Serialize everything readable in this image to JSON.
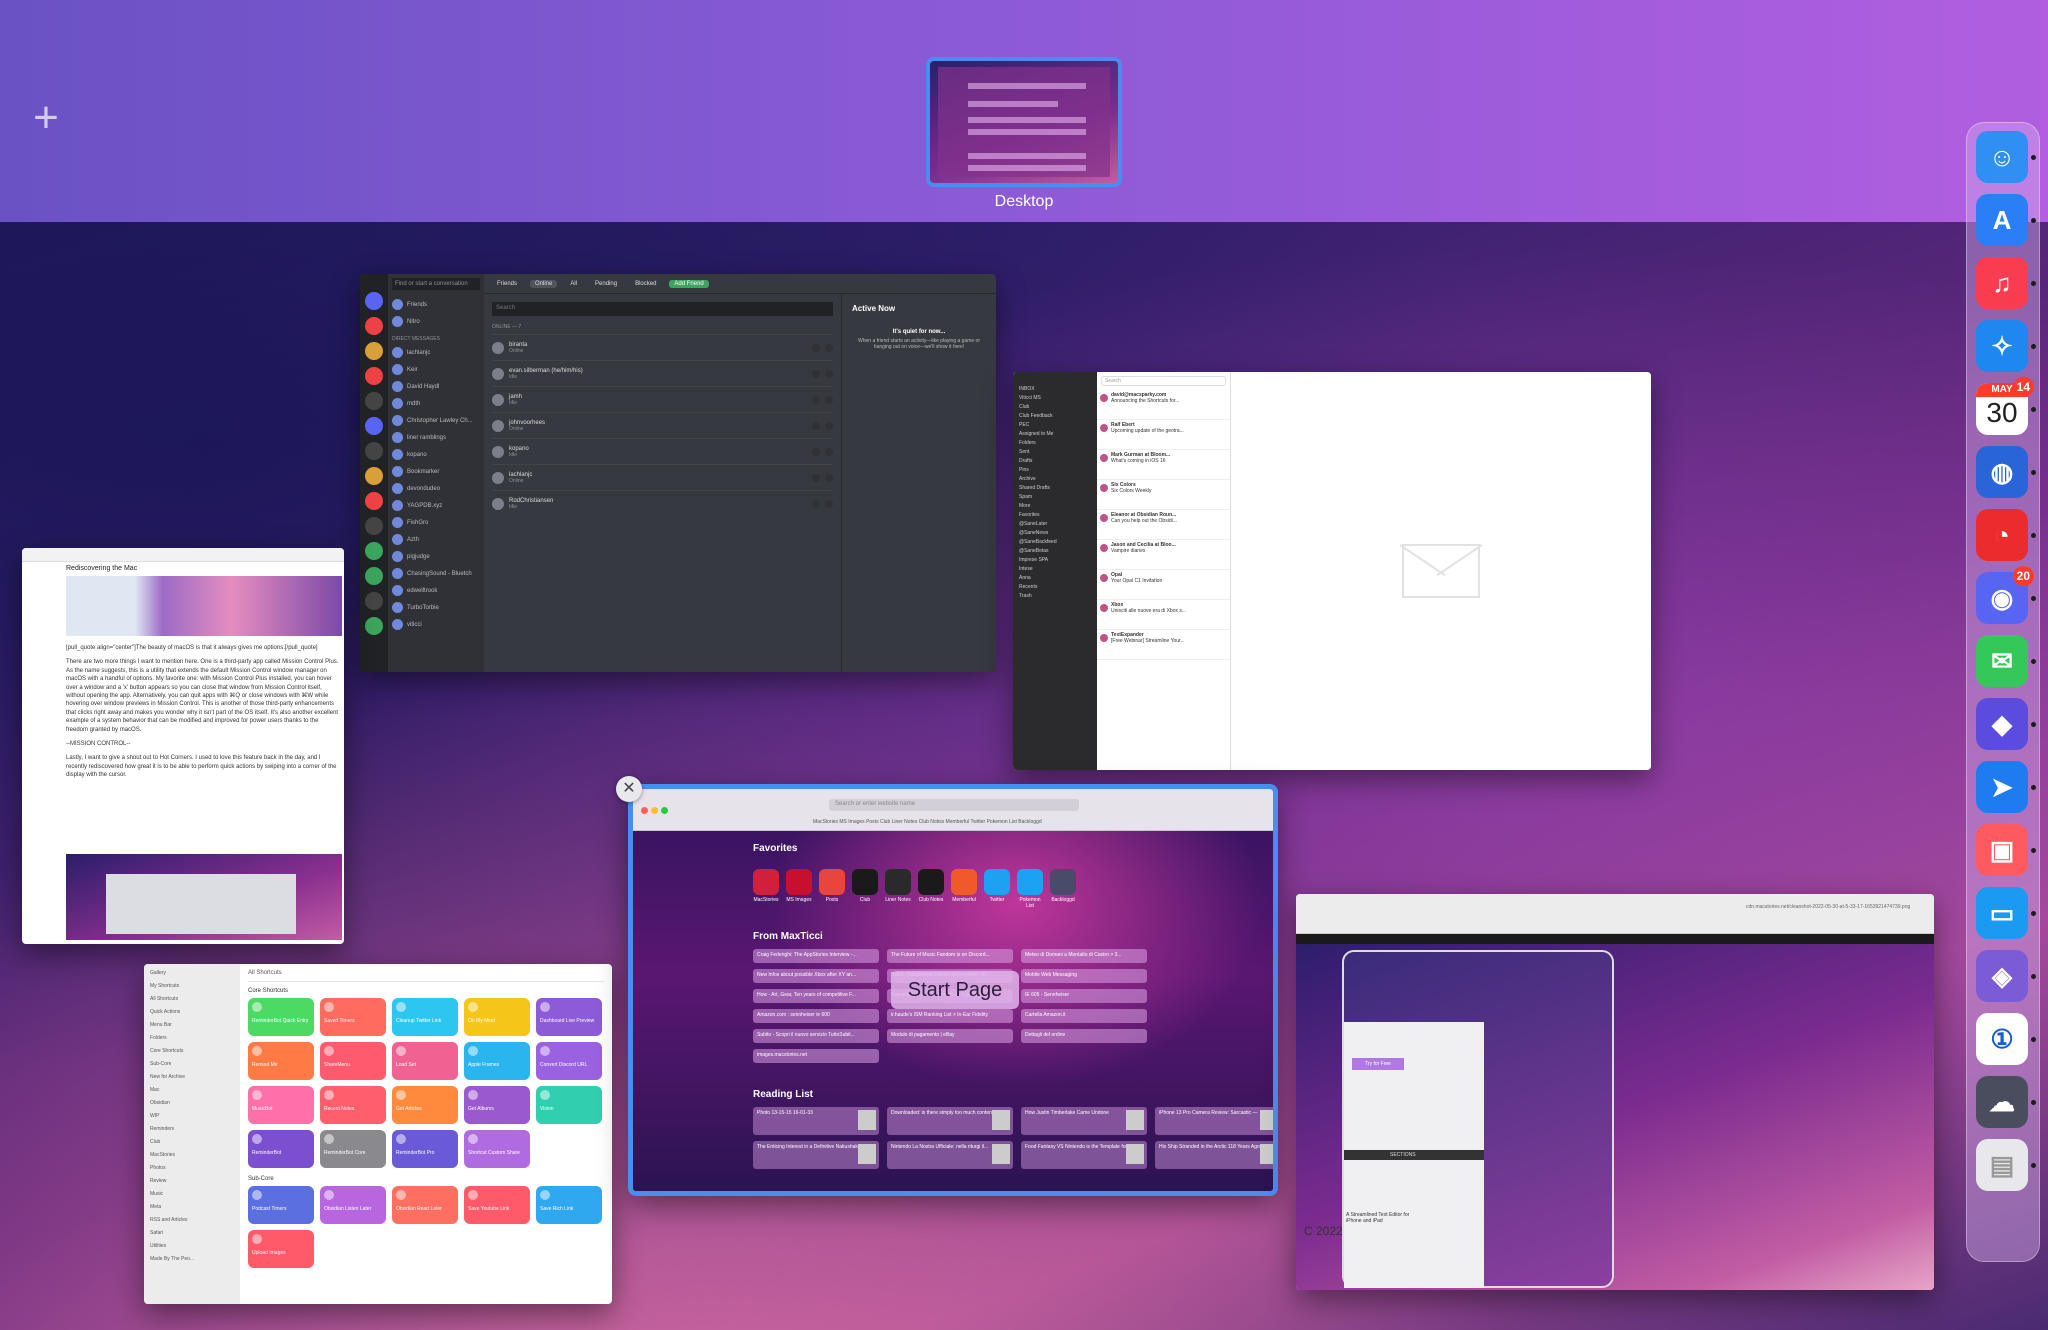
{
  "spaces": {
    "add_symbol": "+",
    "desktop_label": "Desktop"
  },
  "discord": {
    "search_placeholder": "Find or start a conversation",
    "tabs": [
      "Friends",
      "Online",
      "All",
      "Pending",
      "Blocked",
      "Add Friend"
    ],
    "sidebar": {
      "friends": "Friends",
      "nitro": "Nitro",
      "dm_header": "DIRECT MESSAGES",
      "dms": [
        "lachlanjc",
        "Keir",
        "David Haydl",
        "mdth",
        "Christopher Lawley Ch...",
        "liner ramblings",
        "kopano",
        "Bookmarker",
        "devondudeo",
        "YAGPDB.xyz",
        "FishGro",
        "Azth",
        "pigjudge",
        "ChasingSound - Bluetch",
        "edwelltrook",
        "TurboTorbie"
      ],
      "user": "viticci"
    },
    "list": {
      "search": "Search",
      "caption": "ONLINE — 7",
      "friends": [
        {
          "name": "biranta",
          "status": "Online"
        },
        {
          "name": "evan.silberman (he/him/his)",
          "status": "Idle"
        },
        {
          "name": "jamh",
          "status": "Idle"
        },
        {
          "name": "johnvoorhees",
          "status": "Online"
        },
        {
          "name": "kopano",
          "status": "Idle"
        },
        {
          "name": "lachlanjc",
          "status": "Online"
        },
        {
          "name": "RodChristiansen",
          "status": "Idle"
        }
      ]
    },
    "active_now": {
      "title": "Active Now",
      "quiet": "It's quiet for now...",
      "sub": "When a friend starts an activity—like playing a game or hanging out on voice—we'll show it here!"
    }
  },
  "mail": {
    "search": "Search",
    "sidebar": [
      "INBOX",
      "Viticci MS",
      "Club",
      "Club Feedback",
      "PEC",
      "Assigned to Me",
      "Folders",
      "Sent",
      "Drafts",
      "Pins",
      "Archive",
      "Shared Drafts",
      "Spam",
      "More",
      "Favorites",
      "@SaneLater",
      "@SaneNews",
      "@SaneBackfeed",
      "@SaneBetas",
      "Imprese SPA",
      "Intese",
      "Anna",
      "Recents",
      "Trash"
    ],
    "messages": [
      {
        "from": "david@macsparky.com",
        "subject": "Announcing the Shortcuts for..."
      },
      {
        "from": "Ralf Ebert",
        "subject": "Upcoming update of the geotra..."
      },
      {
        "from": "Mark Gurman at Bloom...",
        "subject": "What's coming in iOS 16"
      },
      {
        "from": "Six Colors",
        "subject": "Six Colors Weekly"
      },
      {
        "from": "Eleanor at Obsidian Roun...",
        "subject": "Can you help out the Obsidi..."
      },
      {
        "from": "Jason and Cecilia at Bloo...",
        "subject": "Vampire diaries"
      },
      {
        "from": "Opal",
        "subject": "Your Opal C1 Invitation"
      },
      {
        "from": "Xbox",
        "subject": "Unisciti alle nuove era di Xbox s..."
      },
      {
        "from": "TextExpander",
        "subject": "[Free Webinar] Streamline Your..."
      }
    ]
  },
  "editor": {
    "title": "Rediscovering the Mac",
    "paragraph1": "[pull_quote align=\"center\"]The beauty of macOS is that it always gives me options.[/pull_quote]",
    "paragraph2": "There are two more things I want to mention here. One is a third-party app called Mission Control Plus. As the name suggests, this is a utility that extends the default Mission Control window manager on macOS with a handful of options. My favorite one: with Mission Control Plus installed, you can hover over a window and a 'x' button appears so you can close that window from Mission Control itself, without opening the app. Alternatively, you can quit apps with ⌘Q or close windows with ⌘W while hovering over window previews in Mission Control. This is another of those third-party enhancements that clicks right away and makes you wonder why it isn't part of the OS itself. It's also another excellent example of a system behavior that can be modified and improved for power users thanks to the freedom granted by macOS.",
    "paragraph3": "--MISSION CONTROL--",
    "paragraph4": "Lastly, I want to give a shout out to Hot Corners. I used to love this feature back in the day, and I recently rediscovered how great it is to be able to perform quick actions by swiping into a corner of the display with the cursor."
  },
  "shortcuts": {
    "sidebar": [
      "Gallery",
      "My Shortcuts",
      "All Shortcuts",
      "Quick Actions",
      "Menu Bar",
      "Folders",
      "Core Shortcuts",
      "Sub-Core",
      "New for Archive",
      "Mac",
      "Obsidian",
      "WIP",
      "Reminders",
      "Club",
      "MacStories",
      "Photos",
      "Review",
      "Music",
      "Meta",
      "RSS and Articles",
      "Safari",
      "Utilities",
      "Made By The Peo..."
    ],
    "header": "All Shortcuts",
    "section_core": "Core Shortcuts",
    "section_sub": "Sub-Core",
    "core": [
      {
        "name": "ReminderBot Quick Entry",
        "color": "#4cd964"
      },
      {
        "name": "Saved Timers",
        "color": "#ff6b5e"
      },
      {
        "name": "Cleanup Twitter Link",
        "color": "#2dc6f0"
      },
      {
        "name": "On My Mind",
        "color": "#f5c518"
      },
      {
        "name": "Dashboard Live Preview",
        "color": "#8e5bd8"
      },
      {
        "name": "Remind Me",
        "color": "#ff7a45"
      },
      {
        "name": "ShareMenu",
        "color": "#ff5a6e"
      },
      {
        "name": "Load Set",
        "color": "#f06292"
      },
      {
        "name": "Apple Frames",
        "color": "#2bb5ee"
      },
      {
        "name": "Convert Discord URL",
        "color": "#9a62e0"
      },
      {
        "name": "MusicBot",
        "color": "#ff6fa8"
      },
      {
        "name": "Recent Notes",
        "color": "#ff5f6d"
      },
      {
        "name": "Get Articles",
        "color": "#ff8a3d"
      },
      {
        "name": "Get Albums",
        "color": "#9b59d0"
      },
      {
        "name": "Vision",
        "color": "#2fcfb0"
      },
      {
        "name": "ReminderBot",
        "color": "#7b4fd0"
      },
      {
        "name": "ReminderBot Core",
        "color": "#8a8a8e"
      },
      {
        "name": "ReminderBot Pro",
        "color": "#6a5ad8"
      },
      {
        "name": "Shortcut Custom Share",
        "color": "#b16be0"
      }
    ],
    "sub": [
      {
        "name": "Podcast Timers",
        "color": "#5b6fe0"
      },
      {
        "name": "Obsidian Listen Later",
        "color": "#b865e0"
      },
      {
        "name": "Obsidian Read Later",
        "color": "#ff6f61"
      },
      {
        "name": "Save Youtube Link",
        "color": "#ff5a6a"
      },
      {
        "name": "Save Rich Link",
        "color": "#2fa8f0"
      },
      {
        "name": "Upload Images",
        "color": "#ff5a6a"
      }
    ]
  },
  "safari": {
    "url_placeholder": "Search or enter website name",
    "bookmarks": "MacStories  MS Images  Posts  Club  Liner Notes  Club Notiss  Memberful  Twitter  Pokemon List  Backloggd",
    "tab_title": "Start Page",
    "favorites_title": "Favorites",
    "favorites": [
      "MacStories",
      "MS Images",
      "Posts",
      "Club",
      "Liner Notes",
      "Club Notes",
      "Memberful",
      "Twitter",
      "Pokemon List",
      "Backloggd"
    ],
    "from_title": "From MaxTicci",
    "from_items": [
      "Craig Federighi: The AppStories Interview -...",
      "The Future of Music Fandom is on Discord...",
      "Meteo di Domani a Montalto di Castro > 3...",
      "New Infos about possible Xbox after XY an...",
      "Start Page",
      "Belkin Thunderbolt 3 dock mini monitor - B...",
      "Mobile Web Messaging",
      "How - Art, Gear, Ten years of competitive F...",
      "Tuscatweb.eu - Tuscateweb.eu il quotidiano...",
      "IE 605 - Sennheiser",
      "Amazon.com : sennheiser ie 600",
      "ir.haude's ISM Ranking List > In-Ear Fidelity",
      "Cartella Amazon.it",
      "Subito - Scopri il nuovo servizio TuttoSubit...",
      "Modulo di pagamento | eBay",
      "Dettagli del ordine",
      "images.macstories.net"
    ],
    "start_page_label": "Start Page",
    "reading_title": "Reading List",
    "reading": [
      "Photo 13-15-15 16-01-33",
      "Downloaded: is there simply too much content",
      "How Justin Timberlake Came Undone",
      "iPhone 13 Pro Camera Review: Sarcastic —",
      "The Enticing Interest in a Definitive Nakushaka",
      "Nintendo La Nostra Ufficiale: nella riturgi il...",
      "Food Fantasy VS Nintendo is the Template for...",
      "His Ship Stranded in the Arctic 118 Years Ago..."
    ]
  },
  "screenshot_window": {
    "path": "cdn.macstories.net/cleanshot-2022-05-30-at-5-33-17-1653921474739.png",
    "try_label": "Try for Free",
    "section_label": "SECTIONS",
    "big_text": "C 2022",
    "caption": "A Streamlined Text Editor for iPhone and iPad"
  },
  "dock": {
    "apps": [
      {
        "name": "Finder",
        "color": "#2f8ff2"
      },
      {
        "name": "App Store",
        "color": "#2a7ff6"
      },
      {
        "name": "Music",
        "color": "#fa3c50"
      },
      {
        "name": "Safari",
        "color": "#1e88f0"
      },
      {
        "name": "Calendar",
        "color": "#ffffff"
      },
      {
        "name": "Network",
        "color": "#2a65d8"
      },
      {
        "name": "Timer",
        "color": "#ec2c2c"
      },
      {
        "name": "Discord",
        "color": "#5865f2"
      },
      {
        "name": "Messages",
        "color": "#34c759"
      },
      {
        "name": "Shortcuts",
        "color": "#5b4cdf"
      },
      {
        "name": "Spark",
        "color": "#1f7cf0"
      },
      {
        "name": "Photos Editor",
        "color": "#ff5a5f"
      },
      {
        "name": "Screen Sharing",
        "color": "#1a9af0"
      },
      {
        "name": "Obsidian",
        "color": "#7b5bd6"
      },
      {
        "name": "1Password",
        "color": "#ffffff"
      },
      {
        "name": "Cloud",
        "color": "#4a4d5e"
      },
      {
        "name": "Trash",
        "color": "#e8e8ec"
      }
    ],
    "calendar": {
      "month": "MAY",
      "day": "30",
      "badge": "14"
    },
    "discord_badge": "20"
  }
}
